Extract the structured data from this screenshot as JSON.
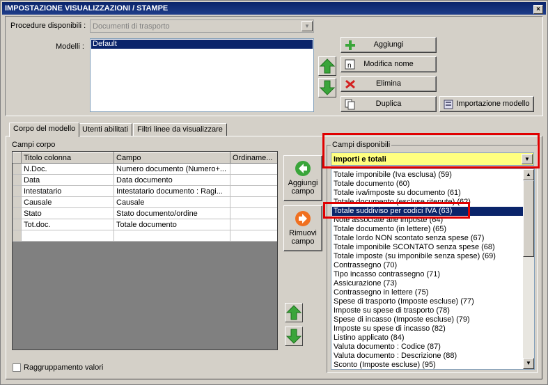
{
  "window": {
    "title": "IMPOSTAZIONE VISUALIZZAZIONI / STAMPE",
    "close_glyph": "×"
  },
  "top": {
    "procedure_label": "Procedure disponibili :",
    "procedure_value": "Documenti di trasporto",
    "modelli_label": "Modelli :",
    "modelli": [
      "Default"
    ],
    "buttons": {
      "aggiungi": "Aggiungi",
      "modifica": "Modifica nome",
      "elimina": "Elimina",
      "duplica": "Duplica",
      "importazione": "Importazione modello"
    }
  },
  "tabs": [
    "Corpo del modello",
    "Utenti abilitati",
    "Filtri linee da visualizzare"
  ],
  "campi_corpo": {
    "label": "Campi corpo",
    "headers": [
      "Titolo colonna",
      "Campo",
      "Ordiname..."
    ],
    "rows": [
      [
        "N.Doc.",
        "Numero documento (Numero+...",
        ""
      ],
      [
        "Data",
        "Data documento",
        ""
      ],
      [
        "Intestatario",
        "Intestatario documento : Ragi...",
        ""
      ],
      [
        "Causale",
        "Causale",
        ""
      ],
      [
        "Stato",
        "Stato documento/ordine",
        ""
      ],
      [
        "Tot.doc.",
        "Totale documento",
        ""
      ]
    ]
  },
  "middle_buttons": {
    "aggiungi_campo": "Aggiungi campo",
    "rimuovi_campo": "Rimuovi campo"
  },
  "raggruppamento_label": "Raggruppamento valori",
  "campi_disponibili": {
    "label": "Campi disponibili",
    "category": "Importi e totali",
    "selected_index": 4,
    "items": [
      "Totale imponibile (Iva esclusa) (59)",
      "Totale documento (60)",
      "Totale iva/imposte su documento (61)",
      "Totale documento (escluse ritenute) (62)",
      "Totale suddiviso per codici IVA (63)",
      "Note associate alle imposte (64)",
      "Totale documento (in lettere) (65)",
      "Totale lordo NON scontato senza spese (67)",
      "Totale imponibile SCONTATO senza spese (68)",
      "Totale imposte (su imponibile senza spese) (69)",
      "Contrassegno (70)",
      "Tipo incasso contrassegno (71)",
      "Assicurazione (73)",
      "Contrassegno in lettere (75)",
      "Spese di trasporto (Imposte escluse) (77)",
      "Imposte su spese di trasporto (78)",
      "Spese di incasso (Imposte escluse) (79)",
      "Imposte su spese di incasso (82)",
      "Listino applicato (84)",
      "Valuta documento : Codice (87)",
      "Valuta documento : Descrizione (88)",
      "Sconto (Imposte escluse) (95)"
    ]
  },
  "colors": {
    "green_arrow": "#3aa53a",
    "red_x": "#d42020",
    "orange_arrow": "#f07020",
    "selection": "#0a246a",
    "highlight_yellow": "#ffff80",
    "annotation_red": "#e00000"
  }
}
